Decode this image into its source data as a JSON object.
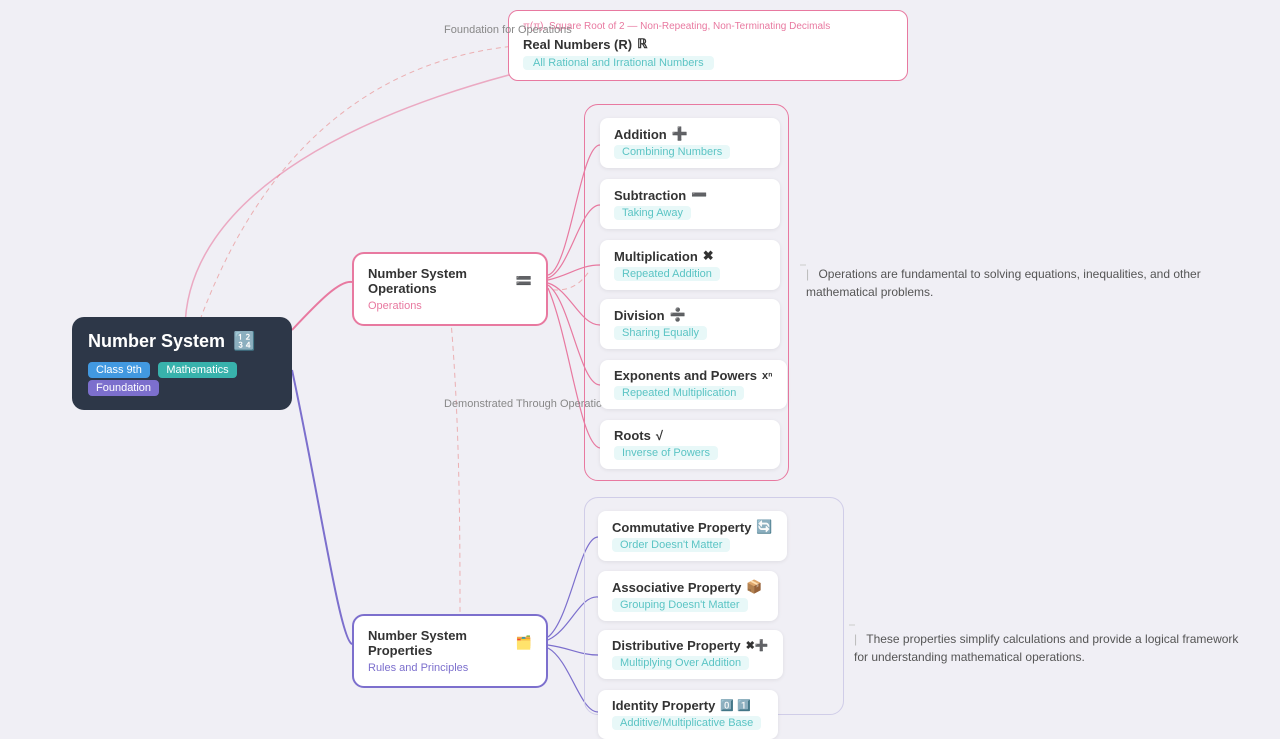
{
  "mainNode": {
    "title": "Number System",
    "emoji": "🔢",
    "tags": [
      "Class 9th",
      "Mathematics",
      "Foundation"
    ]
  },
  "opsNode": {
    "title": "Number System Operations",
    "emoji": "🟰",
    "subtitle": "Operations"
  },
  "propsNode": {
    "title": "Number System Properties",
    "emoji": "🗂️",
    "subtitle": "Rules and Principles"
  },
  "opsItems": [
    {
      "title": "Addition",
      "symbol": "➕",
      "subtitle": "Combining Numbers"
    },
    {
      "title": "Subtraction",
      "symbol": "➖",
      "subtitle": "Taking Away"
    },
    {
      "title": "Multiplication",
      "symbol": "✖",
      "subtitle": "Repeated Addition"
    },
    {
      "title": "Division",
      "symbol": "➗",
      "subtitle": "Sharing Equally"
    },
    {
      "title": "Exponents and Powers",
      "symbol": "xⁿ",
      "subtitle": "Repeated Multiplication"
    },
    {
      "title": "Roots",
      "symbol": "√",
      "subtitle": "Inverse of Powers"
    }
  ],
  "propsItems": [
    {
      "title": "Commutative Property",
      "symbol": "🔄",
      "subtitle": "Order Doesn't Matter"
    },
    {
      "title": "Associative Property",
      "symbol": "📦",
      "subtitle": "Grouping Doesn't Matter"
    },
    {
      "title": "Distributive Property",
      "symbol": "✖➕",
      "subtitle": "Multiplying Over Addition"
    },
    {
      "title": "Identity Property",
      "symbol": "0️⃣ 1️⃣",
      "subtitle": "Additive/Multiplicative Base"
    }
  ],
  "descOps": "Operations are fundamental to solving equations, inequalities, and other mathematical problems.",
  "descProps": "These properties simplify calculations and provide a logical framework for understanding mathematical operations.",
  "labelOps": "Foundation for Operations",
  "labelDemo": "Demonstrated Through Operations",
  "realNumbers": {
    "topText": "π(π), Square Root of 2 — Non-Repeating, Non-Terminating Decimals",
    "title": "Real Numbers (R)",
    "symbol": "ℝ",
    "subtitle": "All Rational and Irrational Numbers"
  }
}
